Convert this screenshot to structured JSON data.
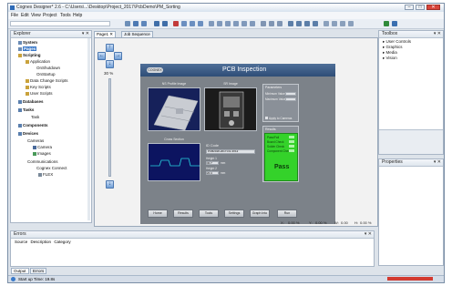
{
  "app": {
    "title": "Cognex Designer* 2.6 - C:\\Users\\...\\Desktop\\Project_2017\\PcbDemo\\PM_Sorting",
    "window_controls": [
      "–",
      "□",
      "✕"
    ]
  },
  "menu": [
    "File",
    "Edit",
    "View",
    "Project",
    "Tools",
    "Help"
  ],
  "explorer": {
    "title": "Explorer",
    "items": [
      {
        "label": "System",
        "icon": "system-icon"
      },
      {
        "label": "Pages",
        "icon": "pages-icon",
        "selected": true
      },
      {
        "label": "Scripting",
        "icon": "script-icon"
      },
      {
        "label": "Application",
        "icon": "script-icon"
      },
      {
        "label": "OnShutdown",
        "icon": "script-icon"
      },
      {
        "label": "OnStartup",
        "icon": "script-icon"
      },
      {
        "label": "Data Change Scripts",
        "icon": "script-icon"
      },
      {
        "label": "Key Scripts",
        "icon": "script-icon"
      },
      {
        "label": "User Scripts",
        "icon": "script-icon"
      },
      {
        "label": "Databases",
        "icon": "database-icon"
      },
      {
        "label": "Tasks",
        "icon": "tasks-icon"
      },
      {
        "label": "Task",
        "icon": "task-icon"
      },
      {
        "label": "Components",
        "icon": "components-icon"
      },
      {
        "label": "Devices",
        "icon": "devices-icon"
      },
      {
        "label": "Cameras",
        "icon": "camera-icon"
      },
      {
        "label": "Camera",
        "icon": "camera-icon"
      },
      {
        "label": "Images",
        "icon": "image-icon"
      },
      {
        "label": "Communications",
        "icon": "comm-icon"
      },
      {
        "label": "Cognex Connect",
        "icon": "comm-icon"
      },
      {
        "label": "FLEX",
        "icon": "comm-icon"
      }
    ]
  },
  "doc_tabs": [
    "Page1",
    "Job Sequence"
  ],
  "toolbox": {
    "title": "Toolbox",
    "items": [
      "User Controls",
      "Graphics",
      "Media",
      "Vision"
    ]
  },
  "properties": {
    "title": "Properties"
  },
  "errors": {
    "title": "Errors",
    "columns": [
      "Source",
      "Description",
      "Category"
    ]
  },
  "bottom_tabs": [
    "Output",
    "Errors"
  ],
  "status": {
    "text": "Start up Time: 19.8s"
  },
  "hmi": {
    "title": "PCB Inspection",
    "logo": "COGNEX",
    "zoom": "30 %",
    "image1_caption": "NS Profile Image",
    "image2_caption": "SR Image",
    "image3_caption": "Cross Section",
    "params_title": "Parameters",
    "param1": "Minimum Value",
    "param2": "Maximum Value",
    "apply_label": "Apply to Cameras",
    "results_title": "Results",
    "results_rows": [
      "Pass/Fail",
      "Board Check",
      "Solder Check",
      "Component Check"
    ],
    "pass_text": "Pass",
    "id_label": "ID Code",
    "id_value": "PCB2018-2017-D1-3X12",
    "height1_label": "Height 1",
    "height1_value": "30.7",
    "height1_unit": "mm",
    "height2_label": "Height 2",
    "height2_value": "20.4",
    "height2_unit": "mm",
    "buttons": [
      "Home",
      "Results",
      "Tools",
      "Settings",
      "Graph Into",
      "Run"
    ]
  },
  "canvas_status": {
    "x_label": "X:",
    "x_value": "0.00 %",
    "y_label": "Y:",
    "y_value": "0.00 %",
    "w_label": "W:",
    "w_value": "0.00",
    "h_label": "H:",
    "h_value": "0.00 %"
  },
  "colors": {
    "accent": "#3a79c9",
    "pass_green": "#34d22a",
    "hmi_header": "#2e4d77"
  }
}
